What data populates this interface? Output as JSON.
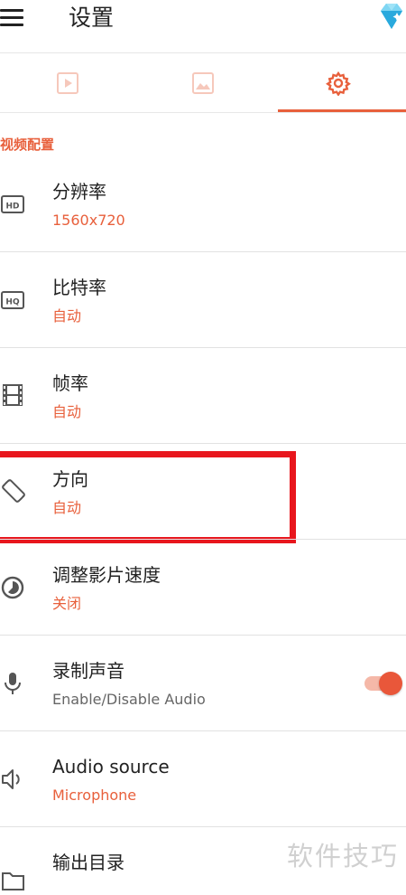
{
  "appbar": {
    "title": "设置",
    "menu_icon": "hamburger-menu-icon",
    "premium_icon": "diamond-gem-icon"
  },
  "tabs": [
    {
      "icon": "video-play-icon",
      "active": false
    },
    {
      "icon": "image-icon",
      "active": false
    },
    {
      "icon": "gear-icon",
      "active": true
    }
  ],
  "section": {
    "header": "视频配置"
  },
  "settings": [
    {
      "id": "resolution",
      "icon": "hd-icon",
      "title": "分辨率",
      "value": "1560x720"
    },
    {
      "id": "bitrate",
      "icon": "hq-icon",
      "title": "比特率",
      "value": "自动"
    },
    {
      "id": "framerate",
      "icon": "film-strip-icon",
      "title": "帧率",
      "value": "自动"
    },
    {
      "id": "orientation",
      "icon": "screen-rotation-icon",
      "title": "方向",
      "value": "自动"
    },
    {
      "id": "speed",
      "icon": "timelapse-icon",
      "title": "调整影片速度",
      "value": "关闭"
    },
    {
      "id": "audio",
      "icon": "microphone-icon",
      "title": "录制声音",
      "value": "Enable/Disable Audio",
      "toggle_on": true
    },
    {
      "id": "audio_source",
      "icon": "speaker-icon",
      "title": "Audio source",
      "value": "Microphone"
    },
    {
      "id": "output_dir",
      "icon": "folder-icon",
      "title": "输出目录",
      "value": ""
    }
  ],
  "watermark": "软件技巧",
  "colors": {
    "accent": "#e8603c",
    "highlight": "#e8161d",
    "toggle_track": "#f5b8a8",
    "toggle_thumb": "#e9573a"
  }
}
